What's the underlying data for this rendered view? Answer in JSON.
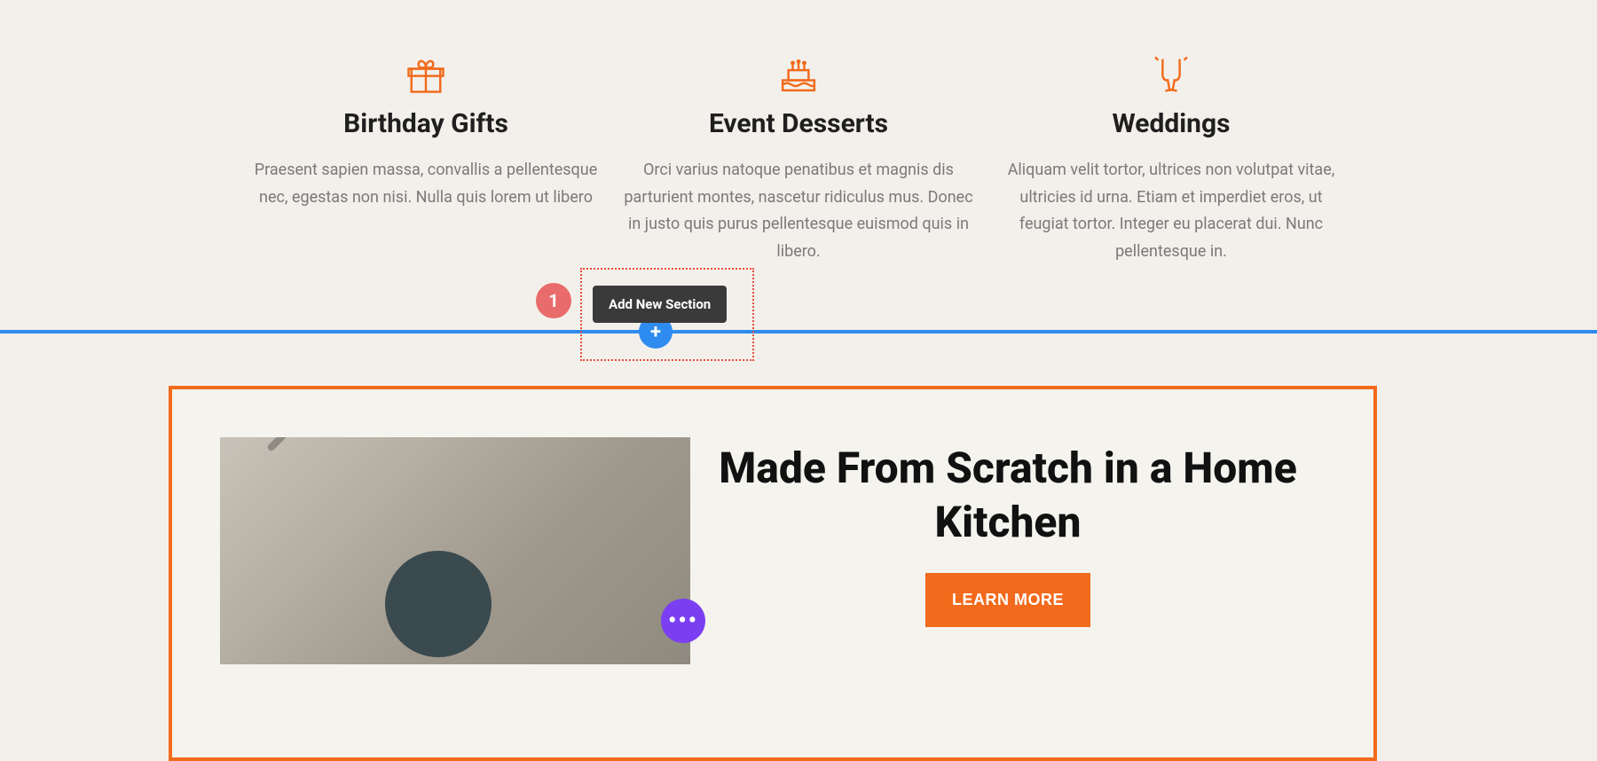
{
  "features": [
    {
      "title": "Birthday Gifts",
      "desc": "Praesent sapien massa, convallis a pellentesque nec, egestas non nisi. Nulla quis lorem ut libero"
    },
    {
      "title": "Event Desserts",
      "desc": "Orci varius natoque penatibus et magnis dis parturient montes, nascetur ridiculus mus. Donec in justo quis purus pellentesque euismod quis in libero."
    },
    {
      "title": "Weddings",
      "desc": "Aliquam velit tortor, ultrices non volutpat vitae, ultricies id urna. Etiam et imperdiet eros, ut feugiat tortor. Integer eu placerat dui. Nunc pellentesque in."
    }
  ],
  "editor": {
    "add_section_label": "Add New Section",
    "plus": "+",
    "step_badge": "1",
    "fab_dots": "•••"
  },
  "hero": {
    "heading": "Made From Scratch in a Home Kitchen",
    "cta": "LEARN MORE"
  }
}
